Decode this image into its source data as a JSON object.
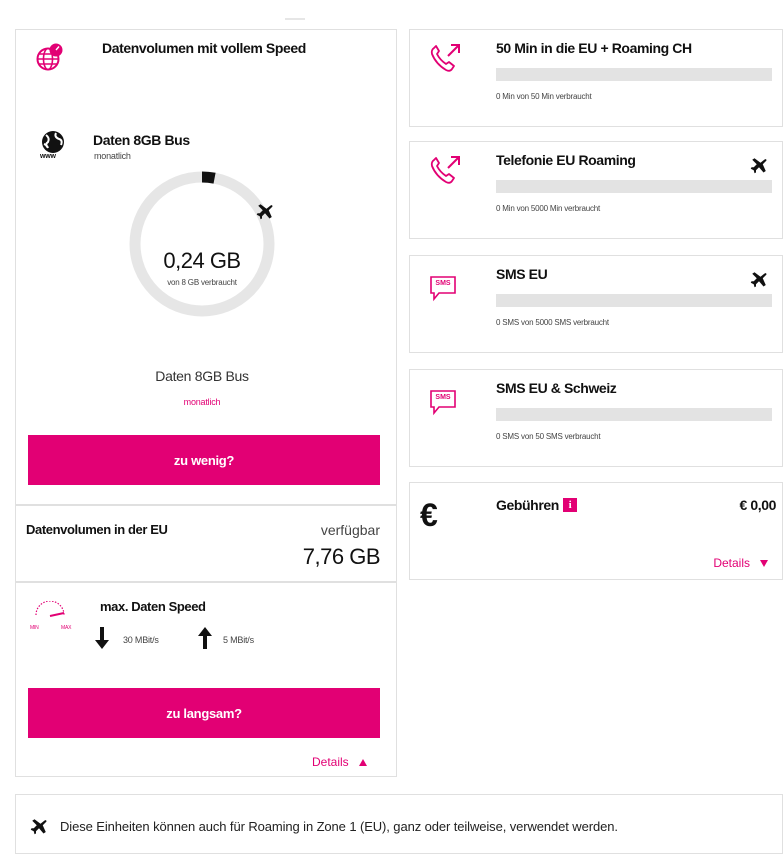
{
  "left": {
    "header_title": "Datenvolumen mit vollem Speed",
    "plan_name": "Daten 8GB Bus",
    "plan_period": "monatlich",
    "www_label": "www",
    "gauge": {
      "used_value": "0,24 GB",
      "used_caption": "von 8 GB verbraucht",
      "used_fraction": 0.03
    },
    "gauge_plan_name": "Daten 8GB Bus",
    "gauge_plan_period": "monatlich",
    "button_little": "zu wenig?",
    "eu_title": "Datenvolumen in der EU",
    "eu_available_label": "verfügbar",
    "eu_available_value": "7,76 GB",
    "speed_title": "max. Daten Speed",
    "speedo_min": "MIN",
    "speedo_max": "MAX",
    "download": "30 MBit/s",
    "upload": "5 MBit/s",
    "button_slow": "zu langsam?",
    "details": "Details"
  },
  "right": [
    {
      "title": "50 Min in die EU + Roaming CH",
      "usage": "0 Min von 50 Min verbraucht",
      "icon": "phone-outgoing-icon",
      "roaming": false
    },
    {
      "title": "Telefonie EU Roaming",
      "usage": "0 Min von 5000 Min verbraucht",
      "icon": "phone-outgoing-icon",
      "roaming": true
    },
    {
      "title": "SMS EU",
      "usage": "0 SMS von 5000 SMS verbraucht",
      "icon": "sms-icon",
      "icon_label": "SMS",
      "roaming": true
    },
    {
      "title": "SMS EU & Schweiz",
      "usage": "0 SMS von 50 SMS verbraucht",
      "icon": "sms-icon",
      "icon_label": "SMS",
      "roaming": false
    }
  ],
  "fees": {
    "title": "Gebühren",
    "info_label": "i",
    "value": "€ 0,00",
    "currency_symbol": "€",
    "details": "Details"
  },
  "footer": {
    "note": "Diese Einheiten können auch für Roaming in Zone 1 (EU), ganz oder teilweise, verwendet werden."
  },
  "colors": {
    "accent": "#e20074",
    "bar": "#e3e3e3",
    "border": "#e0e0e0"
  }
}
